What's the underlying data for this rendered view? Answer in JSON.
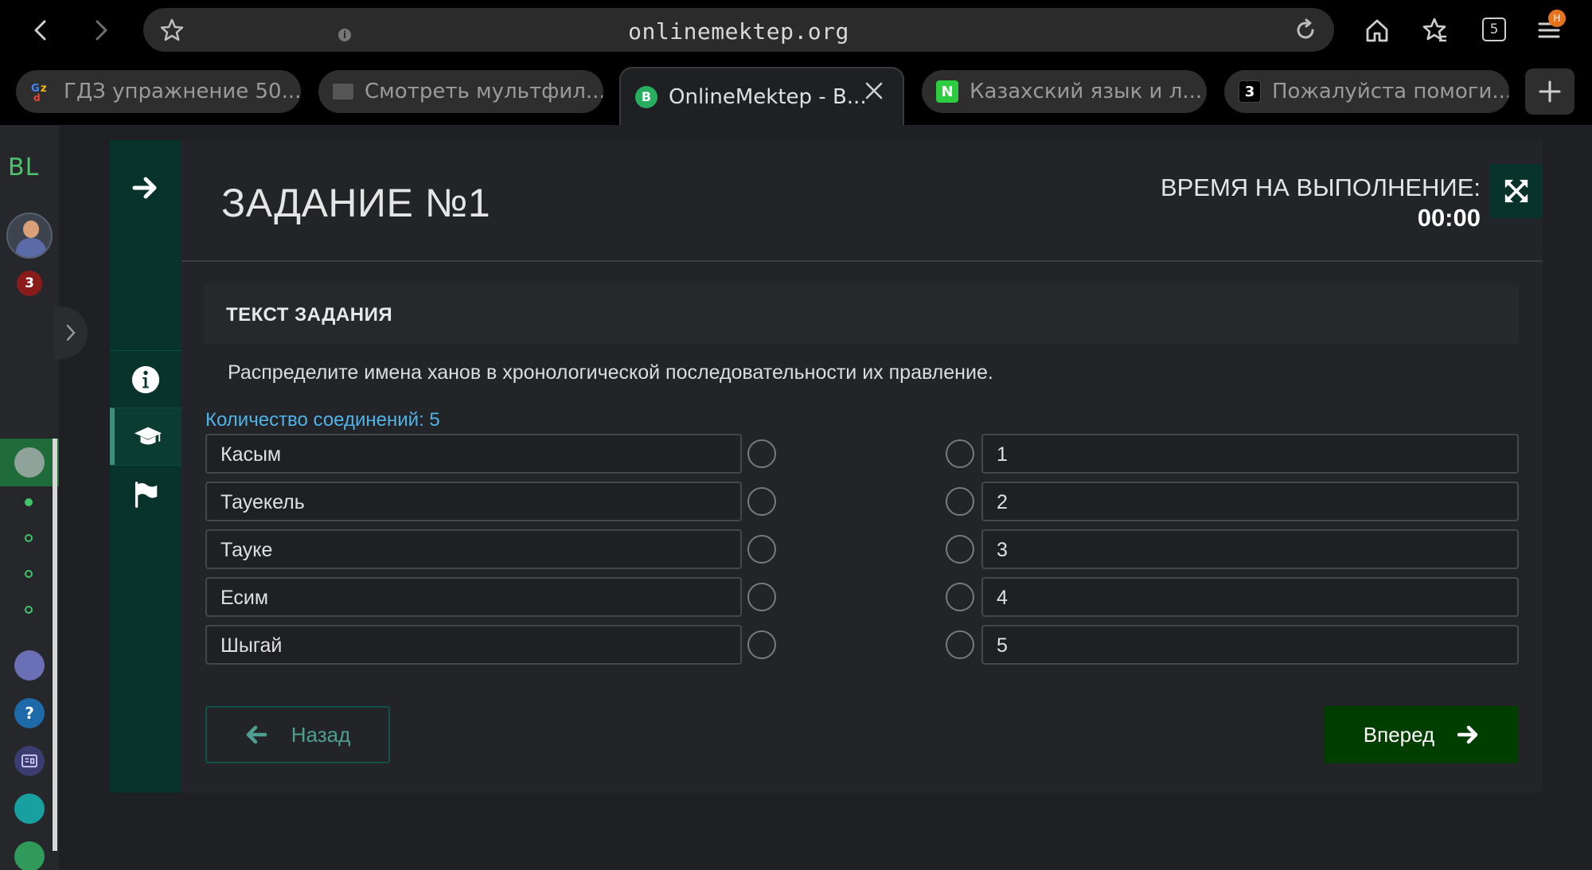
{
  "browser": {
    "url": "onlinemektep.org",
    "tab_count": "5",
    "menu_badge": "H",
    "tabs": [
      {
        "label": "ГДЗ упражнение 50...",
        "favicon": "GDZ"
      },
      {
        "label": "Смотреть мультфил...",
        "favicon": "film-icon"
      },
      {
        "label": "OnlineMektep - В...",
        "favicon": "B"
      },
      {
        "label": "Казахский язык и л...",
        "favicon": "N"
      },
      {
        "label": "Пожалуйста помоги...",
        "favicon": "3"
      }
    ]
  },
  "sidebar": {
    "logo": "BL",
    "notification_count": "3",
    "help_icon": "?"
  },
  "task": {
    "title": "ЗАДАНИЕ №1",
    "timer_label": "ВРЕМЯ НА ВЫПОЛНЕНИЕ:",
    "timer_value": "00:00",
    "section_title": "ТЕКСТ ЗАДАНИЯ",
    "question": "Распределите имена ханов в хронологической последовательности их правление.",
    "connections": "Количество соединений: 5",
    "left_items": [
      "Касым",
      "Тауекель",
      "Тауке",
      "Есим",
      "Шыгай"
    ],
    "right_items": [
      "1",
      "2",
      "3",
      "4",
      "5"
    ],
    "back_label": "Назад",
    "next_label": "Вперед"
  },
  "colors": {
    "accent_green": "#003e00",
    "panel_dark_green": "#08332a",
    "link_blue": "#4fb3e8"
  }
}
